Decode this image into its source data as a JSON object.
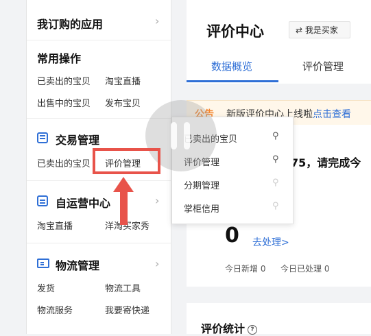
{
  "sidebar": {
    "subscribed": {
      "title": "我订购的应用"
    },
    "common": {
      "title": "常用操作",
      "links": [
        "已卖出的宝贝",
        "淘宝直播",
        "出售中的宝贝",
        "发布宝贝"
      ]
    },
    "trade": {
      "title": "交易管理",
      "links": [
        "已卖出的宝贝",
        "评价管理"
      ],
      "icon": "clipboard-icon"
    },
    "self_op": {
      "title": "自运营中心",
      "links": [
        "淘宝直播",
        "洋淘买家秀"
      ],
      "icon": "chat-icon"
    },
    "logistics": {
      "title": "物流管理",
      "links": [
        "发货",
        "物流工具",
        "物流服务",
        "我要寄快递"
      ],
      "icon": "truck-icon"
    },
    "chevron": "›"
  },
  "flyout": {
    "items": [
      {
        "label": "已卖出的宝贝",
        "pinned": true
      },
      {
        "label": "评价管理",
        "pinned": true
      },
      {
        "label": "分期管理",
        "pinned": false
      },
      {
        "label": "掌柜信用",
        "pinned": false
      }
    ],
    "pin_glyph": "⚲"
  },
  "header": {
    "title": "评价中心",
    "role_switch": "⇄ 我是买家",
    "tabs": [
      "数据概览",
      "评价管理"
    ],
    "active_tab": 0
  },
  "notice": {
    "tag": "公告",
    "text": "新版评价中心上线啦",
    "link": "点击查看"
  },
  "overview": {
    "prompt": "75，请完成今",
    "count": "0",
    "action": "去处理>",
    "today_new": "今日新增 0",
    "today_done": "今日已处理 0"
  },
  "stats": {
    "title": "评价统计",
    "help": "?"
  },
  "colors": {
    "accent": "#2f6fd6",
    "annotation": "#e8534a",
    "notice_tag": "#f4862f"
  }
}
